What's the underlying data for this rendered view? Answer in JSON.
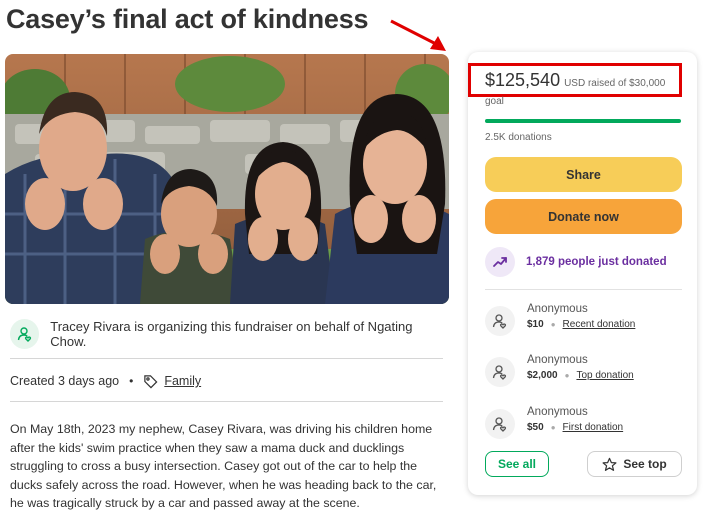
{
  "page_title": "Casey’s final act of kindness",
  "organizer": {
    "text": "Tracey Rivara is organizing this fundraiser on behalf of Ngating Chow."
  },
  "meta": {
    "created": "Created 3 days ago",
    "separator": "•",
    "category": "Family"
  },
  "story": "On May 18th, 2023 my nephew, Casey Rivara, was driving his children home after the kids' swim practice when they saw a mama duck and ducklings struggling to cross a busy intersection. Casey got out of the car to help the ducks safely across the road. However, when he was heading back to the car, he was tragically struck by a car and passed away at the scene.",
  "donation_card": {
    "amount": "$125,540",
    "amount_suffix": "USD raised of $30,000",
    "goal_word": "goal",
    "progress_fraction": 1.0,
    "donation_count": "2.5K donations",
    "share_label": "Share",
    "donate_label": "Donate now",
    "recent_activity": "1,879 people just donated",
    "donors": [
      {
        "name": "Anonymous",
        "amount": "$10",
        "tag": "Recent donation"
      },
      {
        "name": "Anonymous",
        "amount": "$2,000",
        "tag": "Top donation"
      },
      {
        "name": "Anonymous",
        "amount": "$50",
        "tag": "First donation"
      }
    ],
    "see_all_label": "See all",
    "see_top_label": "See top"
  },
  "colors": {
    "brand_green": "#02a95c",
    "share_yellow": "#f7cd58",
    "donate_orange": "#f7a43a",
    "highlight_red": "#e00000",
    "activity_purple": "#6b2fa0"
  },
  "icons": {
    "organizer": "person-heart-icon",
    "category": "tag-icon",
    "trend": "trending-up-icon",
    "donor": "person-heart-icon",
    "see_top": "star-icon"
  }
}
